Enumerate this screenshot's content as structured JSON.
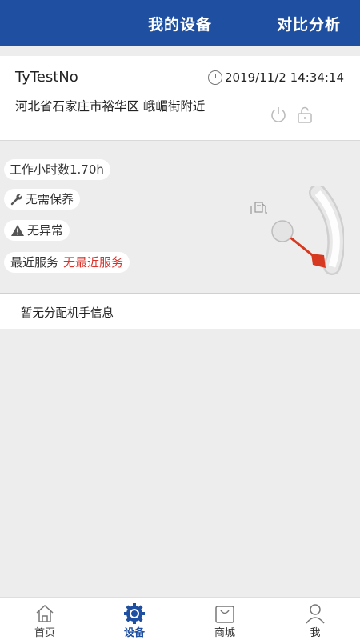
{
  "header": {
    "title": "我的设备",
    "compare_label": "对比分析"
  },
  "device": {
    "name": "TyTestNo",
    "time": "2019/11/2 14:34:14",
    "address": "河北省石家庄市裕华区 峨嵋街附近"
  },
  "status": {
    "work_hours": "工作小时数1.70h",
    "maintenance": "无需保养",
    "abnormal": "无异常",
    "service_label": "最近服务",
    "service_value": "无最近服务"
  },
  "operator_info": "暂无分配机手信息",
  "tabs": [
    {
      "label": "首页",
      "icon": "home-icon"
    },
    {
      "label": "设备",
      "icon": "gear-icon"
    },
    {
      "label": "商城",
      "icon": "shop-bag-icon"
    },
    {
      "label": "我",
      "icon": "user-icon"
    }
  ],
  "colors": {
    "primary": "#1e4fa0",
    "accent_red": "#d9322b",
    "gauge_red": "#d6391f"
  }
}
